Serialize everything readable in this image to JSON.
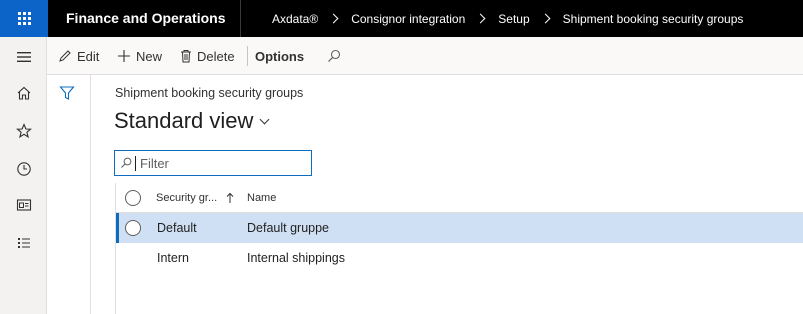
{
  "app": {
    "title": "Finance and Operations"
  },
  "breadcrumb": [
    "Axdata®",
    "Consignor integration",
    "Setup",
    "Shipment booking security groups"
  ],
  "left_nav": {
    "items": [
      "hamburger-icon",
      "home-icon",
      "star-icon",
      "clock-icon",
      "workspace-icon",
      "list-icon"
    ]
  },
  "toolbar": {
    "edit_label": "Edit",
    "new_label": "New",
    "delete_label": "Delete",
    "options_label": "Options"
  },
  "page": {
    "caption": "Shipment booking security groups",
    "view_name": "Standard view"
  },
  "filter": {
    "placeholder": "Filter",
    "value": ""
  },
  "grid": {
    "columns": [
      "Security gr...",
      "Name"
    ],
    "rows": [
      {
        "group": "Default",
        "name": "Default gruppe",
        "selected": true
      },
      {
        "group": "Intern",
        "name": "Internal shippings",
        "selected": false
      }
    ]
  },
  "colors": {
    "accent": "#0f6cbd",
    "waffle_bg": "#0c64c9",
    "selected_row": "#cfe0f4",
    "topbar": "#000000"
  }
}
